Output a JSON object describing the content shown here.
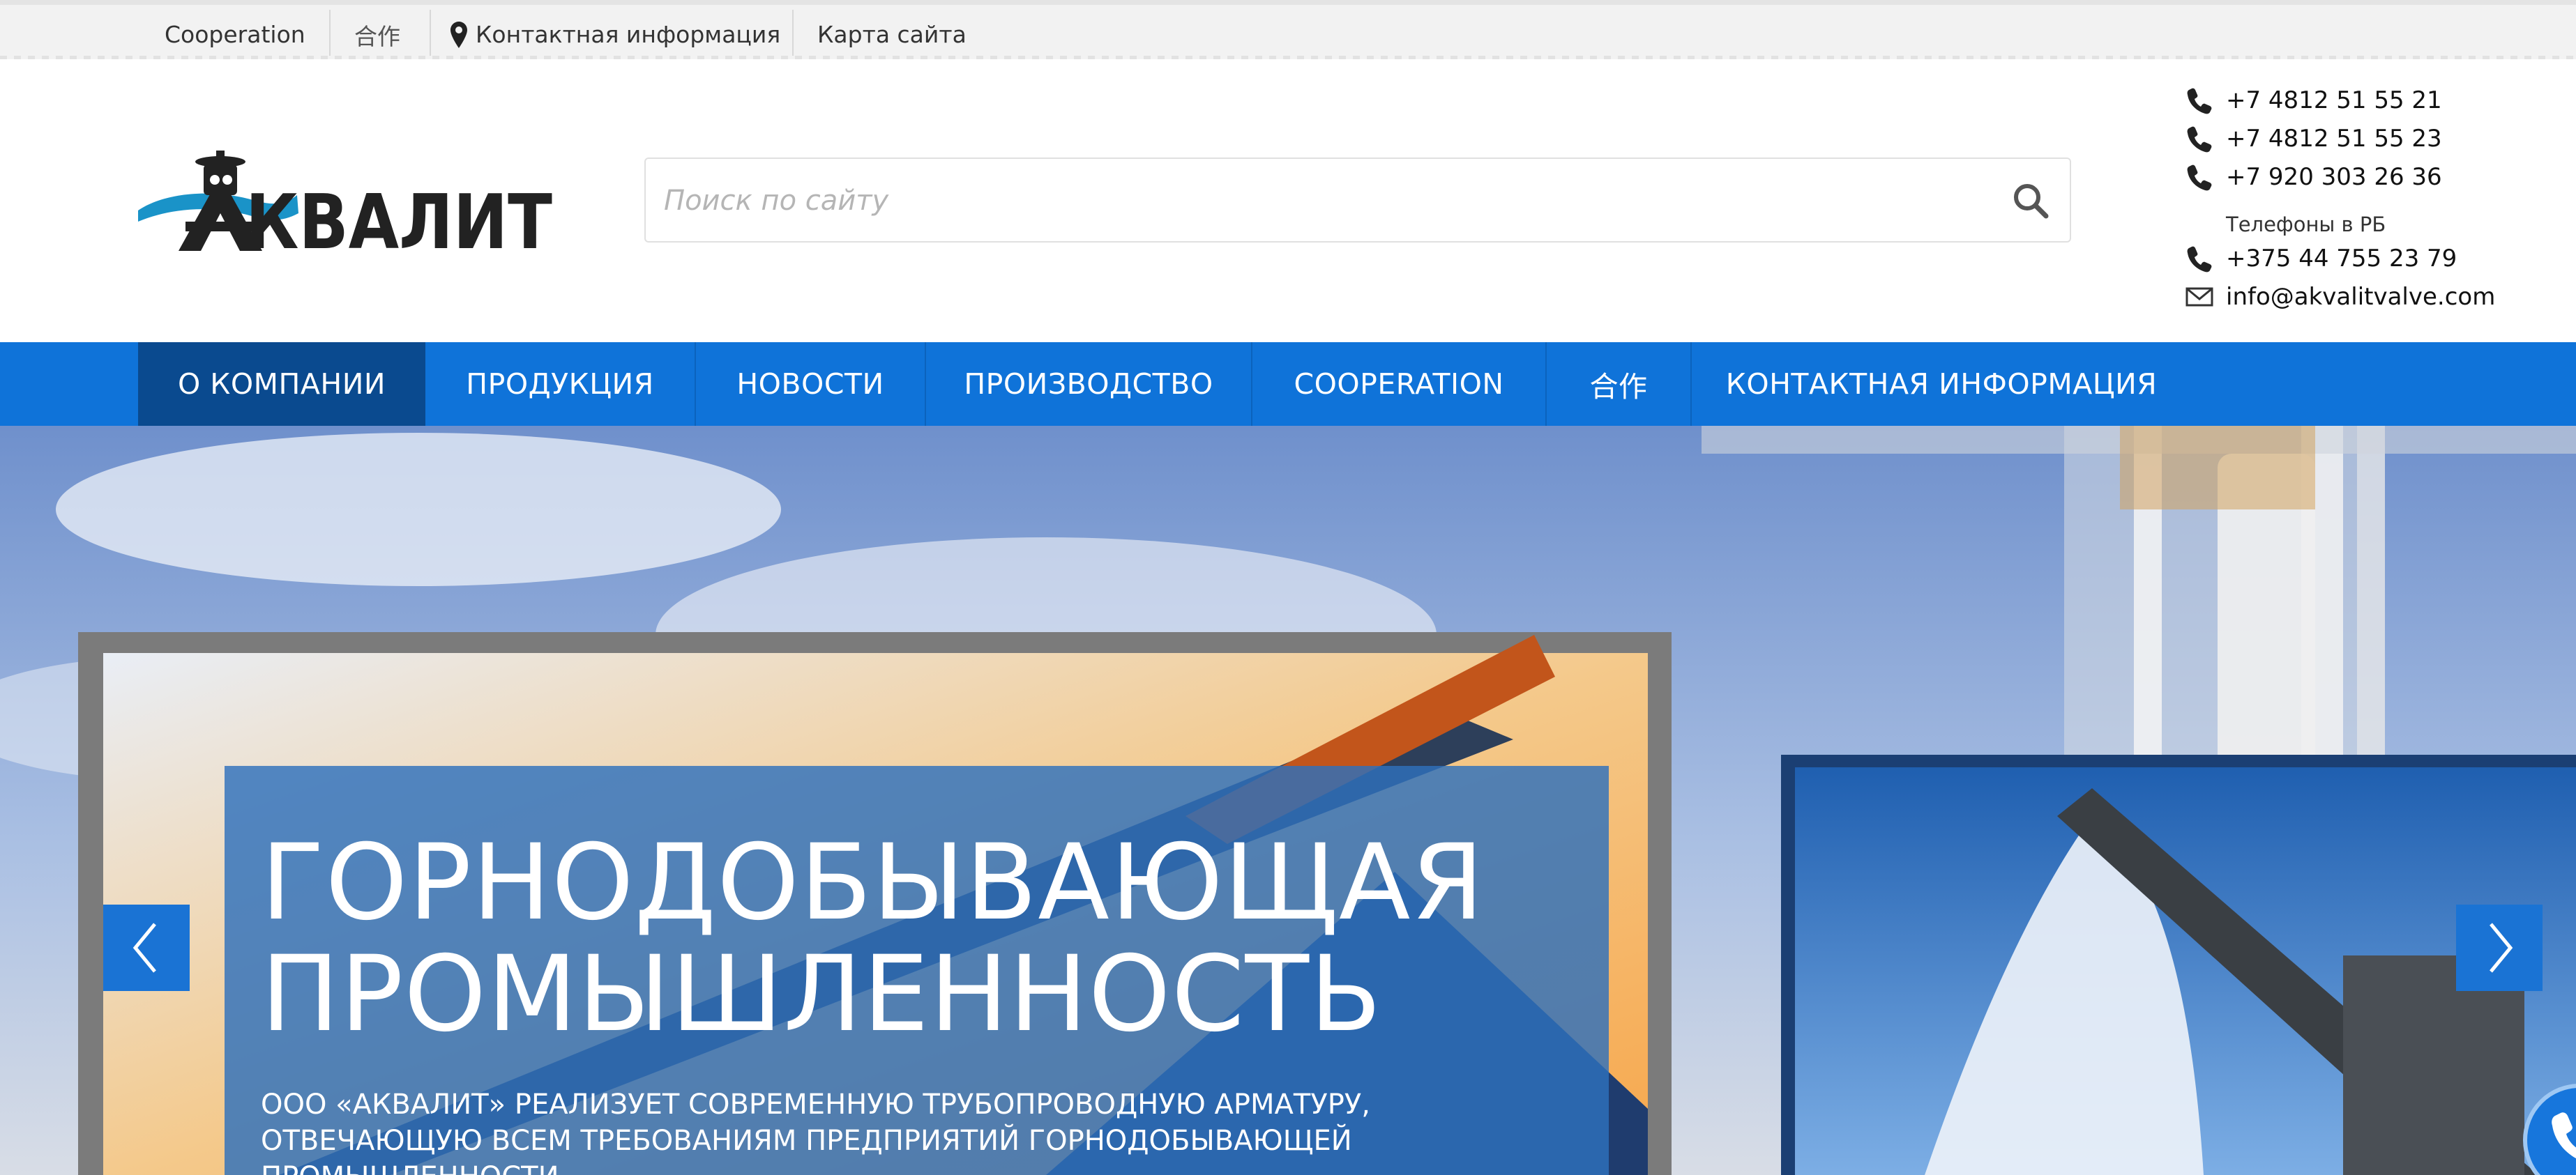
{
  "topbar": {
    "links": [
      "Cooperation",
      "合作",
      "Контактная информация",
      "Карта сайта"
    ]
  },
  "logo": {
    "text": "АКВАЛИТ"
  },
  "search": {
    "placeholder": "Поиск по сайту"
  },
  "contacts": {
    "phones": [
      "+7 4812 51 55 21",
      "+7 4812 51 55 23",
      "+7 920 303 26 36"
    ],
    "rb_label": "Телефоны в РБ",
    "rb_phone": "+375 44 755 23 79",
    "email": "info@akvalitvalve.com"
  },
  "nav": {
    "items": [
      "О КОМПАНИИ",
      "ПРОДУКЦИЯ",
      "НОВОСТИ",
      "ПРОИЗВОДСТВО",
      "COOPERATION",
      "合作",
      "КОНТАКТНАЯ ИНФОРМАЦИЯ"
    ],
    "active": "О КОМПАНИИ"
  },
  "hero": {
    "title_line1": "ГОРНОДОБЫВАЮЩАЯ",
    "title_line2": "ПРОМЫШЛЕННОСТЬ",
    "text_line1": "ООО «АКВАЛИТ» РЕАЛИЗУЕТ СОВРЕМЕННУЮ ТРУБОПРОВОДНУЮ АРМАТУРУ,",
    "text_line2": "ОТВЕЧАЮЩУЮ ВСЕМ ТРЕБОВАНИЯМ ПРЕДПРИЯТИЙ ГОРНОДОБЫВАЮЩЕЙ ПРОМЫШЛЕННОСТИ"
  },
  "colors": {
    "nav": "#0f73d9",
    "nav_active": "#0a4a8f",
    "caption": "#2e70bc"
  },
  "icons": [
    "map-pin-icon",
    "search-icon",
    "phone-icon",
    "envelope-icon",
    "arrow-left-icon",
    "arrow-right-icon",
    "phone-callback-icon"
  ]
}
